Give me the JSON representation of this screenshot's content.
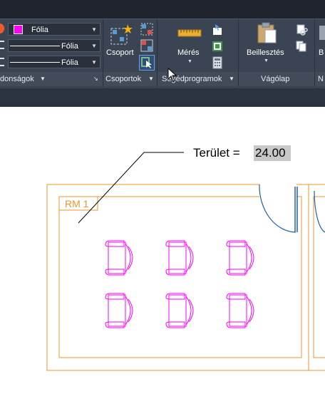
{
  "ribbon": {
    "properties": {
      "color_value": "Fólia",
      "linetype_value": "Fólia",
      "lineweight_value": "Fólia",
      "panel_label": "donságok",
      "color_swatch": "#ff00ff"
    },
    "groups": {
      "group_label": "Csoport",
      "panel_label": "Csoportok"
    },
    "utilities": {
      "measure_label": "Mérés",
      "panel_label": "Segédprogramok"
    },
    "clipboard": {
      "paste_label": "Beillesztés",
      "panel_label": "Vágólap"
    },
    "clipped": {
      "button_label": "B",
      "panel_label": "N"
    }
  },
  "drawing": {
    "area_label": "Terület = ",
    "area_value": "24.00",
    "room_tag": "RM 1",
    "colors": {
      "walls": "#e8962e",
      "chairs": "#ff00ff",
      "door": "#1f5fa8",
      "leader": "#000000"
    }
  }
}
